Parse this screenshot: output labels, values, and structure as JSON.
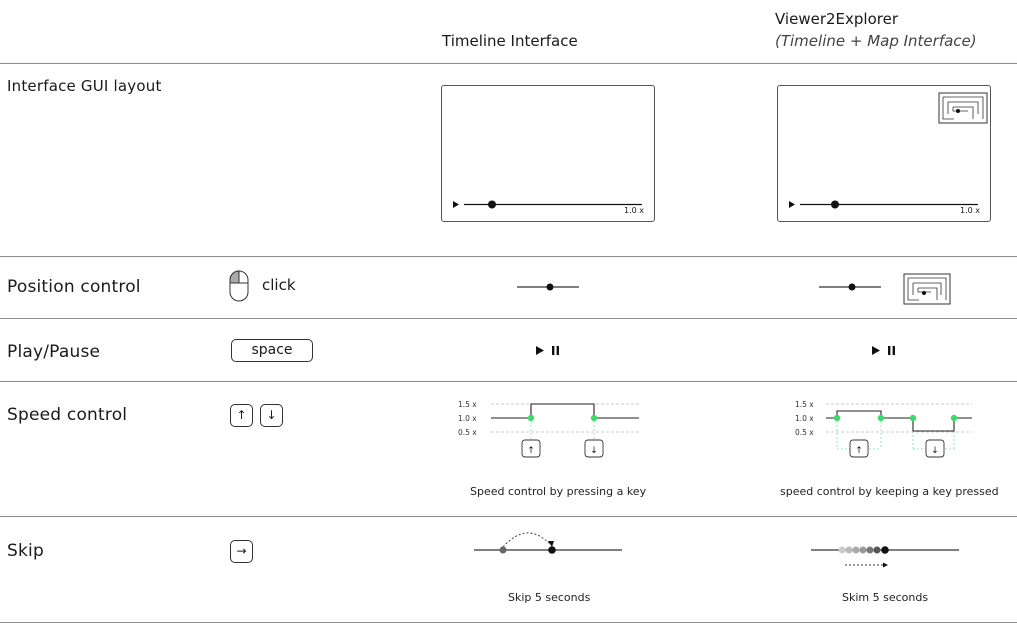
{
  "header": {
    "timeline_title": "Timeline Interface",
    "explorer_title": "Viewer2Explorer",
    "explorer_subtitle": "(Timeline + Map Interface)"
  },
  "rows": {
    "gui_layout": "Interface GUI layout",
    "position": "Position control",
    "play_pause": "Play/Pause",
    "speed": "Speed control",
    "skip": "Skip"
  },
  "inputs": {
    "click_label": "click",
    "space_label": "space",
    "up_arrow": "↑",
    "down_arrow": "↓",
    "right_arrow": "→"
  },
  "gui": {
    "timeline_speed": "1.0 x",
    "explorer_speed": "1.0 x"
  },
  "speed_chart": {
    "levels": [
      "1.5 x",
      "1.0 x",
      "0.5 x"
    ],
    "timeline_caption": "Speed control by pressing a key",
    "explorer_caption": "speed control by keeping a key pressed"
  },
  "skip": {
    "timeline_caption": "Skip 5 seconds",
    "explorer_caption": "Skim 5 seconds"
  },
  "colors": {
    "accent_green": "#3ddc6a",
    "line": "#1a1a1a",
    "divider": "#8c8c8c"
  }
}
